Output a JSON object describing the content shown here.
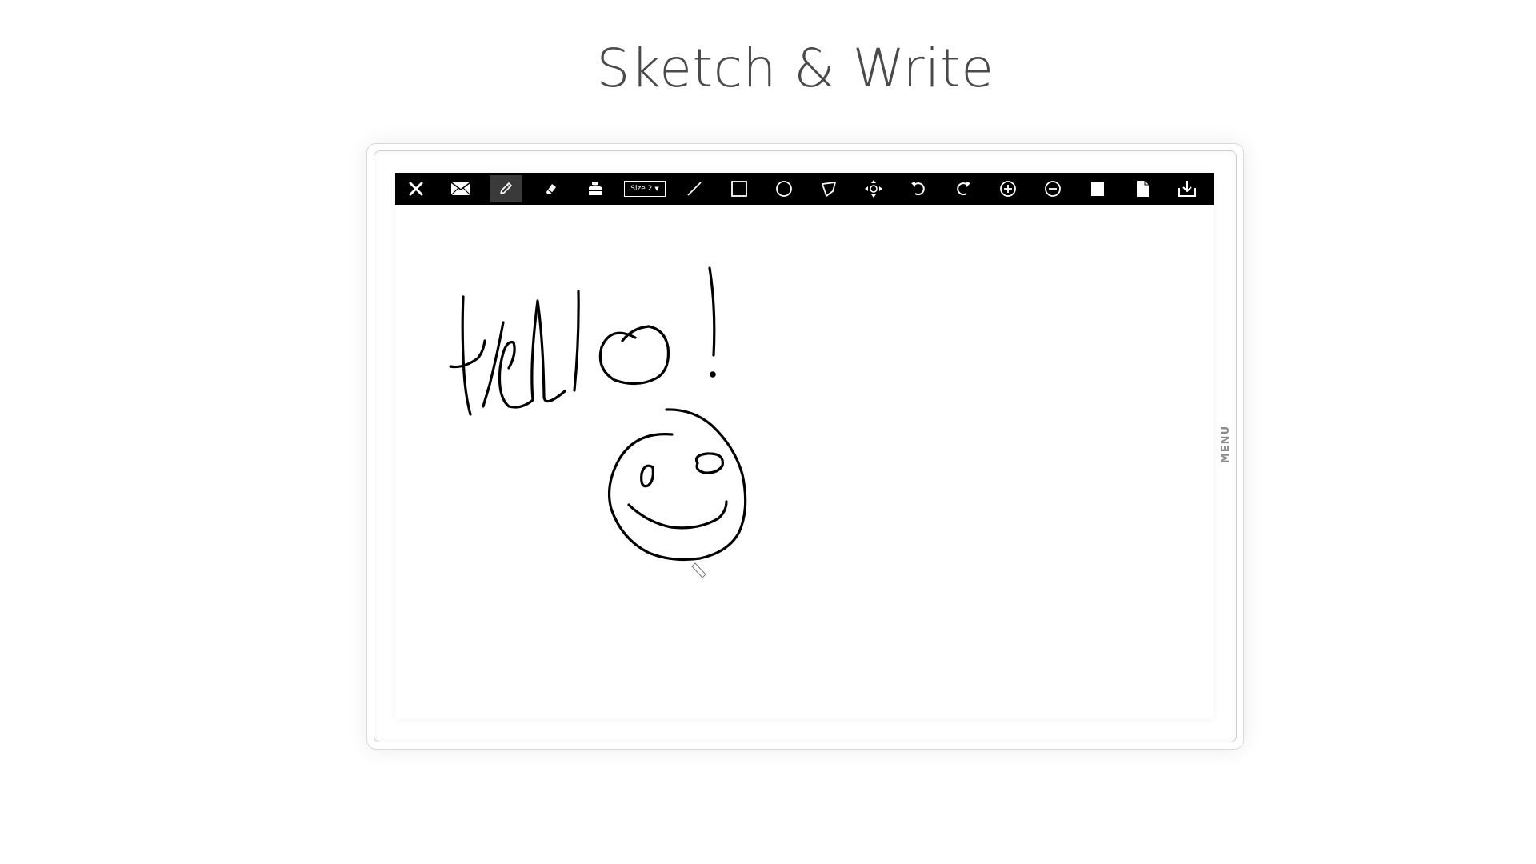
{
  "page": {
    "title": "Sketch & Write"
  },
  "toolbar": {
    "tools": [
      {
        "icon": "close-icon"
      },
      {
        "icon": "mail-icon"
      },
      {
        "icon": "pencil-icon",
        "active": true
      },
      {
        "icon": "eraser-icon"
      },
      {
        "icon": "ink-bottle-icon"
      },
      {
        "icon": "line-icon"
      },
      {
        "icon": "rectangle-icon"
      },
      {
        "icon": "circle-icon"
      },
      {
        "icon": "polygon-icon"
      },
      {
        "icon": "move-icon"
      },
      {
        "icon": "undo-icon"
      },
      {
        "icon": "redo-icon"
      },
      {
        "icon": "zoom-in-icon"
      },
      {
        "icon": "zoom-out-icon"
      },
      {
        "icon": "fill-rectangle-icon"
      },
      {
        "icon": "new-page-icon"
      },
      {
        "icon": "save-download-icon"
      }
    ],
    "size_select": {
      "value": "Size 2"
    }
  },
  "canvas": {
    "drawing": "Hello!",
    "background_color": "#ffffff",
    "ink_color": "#000000"
  },
  "side_menu": {
    "label": "MENU"
  },
  "colors": {
    "toolbar_background": "#000000",
    "toolbar_icon": "#ffffff",
    "active_tool_background": "#3a3a3a",
    "title_text": "#4a4a4a",
    "menu_label": "#8c8c8c"
  }
}
